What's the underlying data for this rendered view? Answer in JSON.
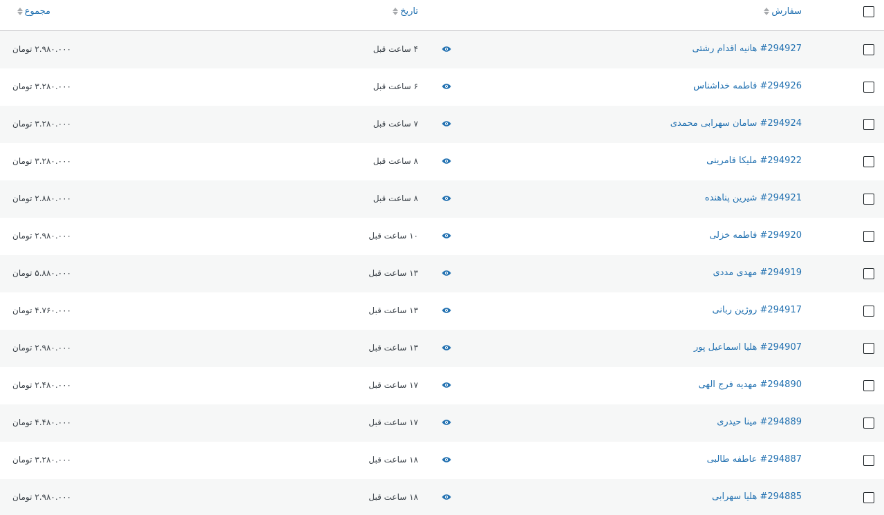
{
  "header": {
    "order_label": "سفارش",
    "date_label": "تاریخ",
    "total_label": "مجموع"
  },
  "accent_color": "#2271b1",
  "rows": [
    {
      "order": "#294927 هانیه اقدام رشتی",
      "date": "۴ ساعت قبل",
      "total": "۲.۹۸۰.۰۰۰ تومان"
    },
    {
      "order": "#294926 فاطمه خداشناس",
      "date": "۶ ساعت قبل",
      "total": "۳.۲۸۰.۰۰۰ تومان"
    },
    {
      "order": "#294924 سامان سهرابی محمدی",
      "date": "۷ ساعت قبل",
      "total": "۳.۲۸۰.۰۰۰ تومان"
    },
    {
      "order": "#294922 ملیکا قامرینی",
      "date": "۸ ساعت قبل",
      "total": "۳.۲۸۰.۰۰۰ تومان"
    },
    {
      "order": "#294921 شیرین پناهنده",
      "date": "۸ ساعت قبل",
      "total": "۲.۸۸۰.۰۰۰ تومان"
    },
    {
      "order": "#294920 فاطمه خزلی",
      "date": "۱۰ ساعت قبل",
      "total": "۲.۹۸۰.۰۰۰ تومان"
    },
    {
      "order": "#294919 مهدی مددی",
      "date": "۱۳ ساعت قبل",
      "total": "۵.۸۸۰.۰۰۰ تومان"
    },
    {
      "order": "#294917 روژین ربانی",
      "date": "۱۳ ساعت قبل",
      "total": "۴.۷۶۰.۰۰۰ تومان"
    },
    {
      "order": "#294907 هلیا اسماعیل پور",
      "date": "۱۳ ساعت قبل",
      "total": "۲.۹۸۰.۰۰۰ تومان"
    },
    {
      "order": "#294890 مهدیه فرج الهی",
      "date": "۱۷ ساعت قبل",
      "total": "۲.۴۸۰.۰۰۰ تومان"
    },
    {
      "order": "#294889 مینا حیدری",
      "date": "۱۷ ساعت قبل",
      "total": "۴.۴۸۰.۰۰۰ تومان"
    },
    {
      "order": "#294887 عاطفه طالبی",
      "date": "۱۸ ساعت قبل",
      "total": "۳.۲۸۰.۰۰۰ تومان"
    },
    {
      "order": "#294885 هلیا سهرابی",
      "date": "۱۸ ساعت قبل",
      "total": "۲.۹۸۰.۰۰۰ تومان"
    }
  ]
}
